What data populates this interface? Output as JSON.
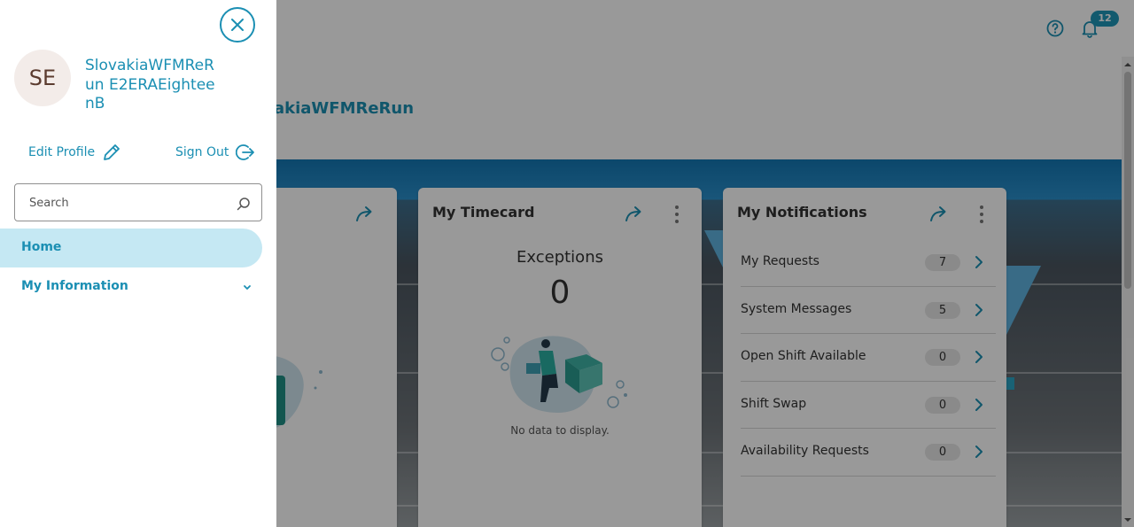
{
  "header": {
    "help_icon": "help-circle-icon",
    "notifications_icon": "bell-icon",
    "notifications_badge": "12"
  },
  "welcome": {
    "text": "ck, SlovakiaWFMReRun"
  },
  "cards": {
    "timecard": {
      "title": "My Timecard",
      "exceptions_label": "Exceptions",
      "exceptions_value": "0",
      "empty_text": "No data to display."
    },
    "notifications": {
      "title": "My Notifications",
      "items": [
        {
          "label": "My Requests",
          "count": "7"
        },
        {
          "label": "System Messages",
          "count": "5"
        },
        {
          "label": "Open Shift Available",
          "count": "0"
        },
        {
          "label": "Shift Swap",
          "count": "0"
        },
        {
          "label": "Availability Requests",
          "count": "0"
        }
      ]
    }
  },
  "drawer": {
    "avatar_initials": "SE",
    "user_name": "SlovakiaWFMReRun E2ERAEighteenB",
    "edit_profile_label": "Edit Profile",
    "sign_out_label": "Sign Out",
    "search_placeholder": "Search",
    "nav": {
      "home": "Home",
      "my_information": "My Information"
    }
  },
  "colors": {
    "accent": "#1b8fb3",
    "nav_active_bg": "#c5e8f3",
    "badge_bg": "#1f97b8",
    "overlay": "rgba(0,0,0,0.4)"
  }
}
